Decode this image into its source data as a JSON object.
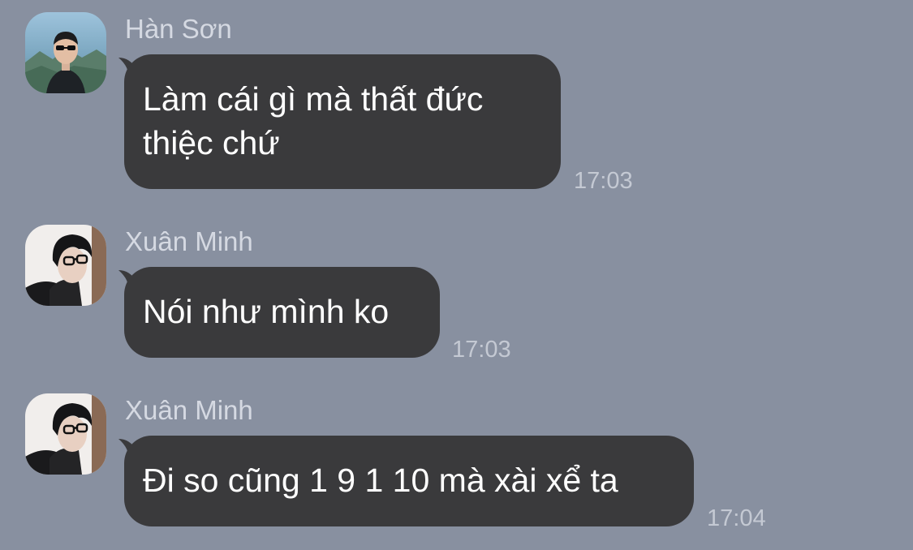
{
  "colors": {
    "background": "#8890a0",
    "bubble": "#3a3a3c",
    "bubble_text": "#ffffff",
    "sender_name": "#d5d9e2",
    "timestamp": "#c4c9d3"
  },
  "messages": [
    {
      "sender": "Hàn Sơn",
      "avatar": "han-son-avatar",
      "text": "Làm cái gì mà thất đức\nthiệc chứ",
      "time": "17:03"
    },
    {
      "sender": "Xuân Minh",
      "avatar": "xuan-minh-avatar",
      "text": "Nói như mình ko",
      "time": "17:03"
    },
    {
      "sender": "Xuân Minh",
      "avatar": "xuan-minh-avatar",
      "text": "Đi so cũng 1 9 1 10 mà xài xể ta",
      "time": "17:04"
    }
  ]
}
